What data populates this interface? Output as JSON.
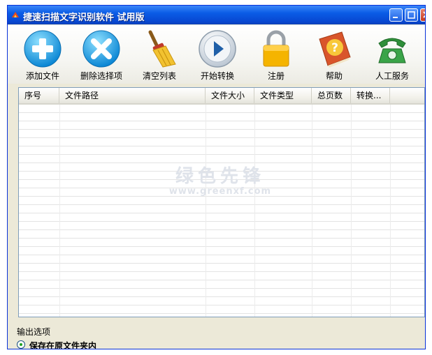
{
  "window": {
    "title": "捷速扫描文字识别软件  试用版"
  },
  "toolbar": {
    "items": [
      {
        "label": "添加文件",
        "icon": "add-icon"
      },
      {
        "label": "删除选择项",
        "icon": "delete-icon"
      },
      {
        "label": "清空列表",
        "icon": "broom-icon"
      },
      {
        "label": "开始转换",
        "icon": "play-icon"
      },
      {
        "label": "注册",
        "icon": "lock-icon"
      },
      {
        "label": "帮助",
        "icon": "help-book-icon"
      },
      {
        "label": "人工服务",
        "icon": "telephone-icon"
      }
    ]
  },
  "file_list": {
    "columns": [
      "序号",
      "文件路径",
      "文件大小",
      "文件类型",
      "总页数",
      "转换..."
    ],
    "rows": []
  },
  "watermark": {
    "line1": "绿色先锋",
    "line2": "www.greenxf.com"
  },
  "output_options": {
    "label": "输出选项",
    "selected_option": "保存在原文件夹内"
  },
  "colors": {
    "titlebar": "#0a5ce6",
    "window_bg": "#ece9d8",
    "list_border": "#7f9db9"
  }
}
